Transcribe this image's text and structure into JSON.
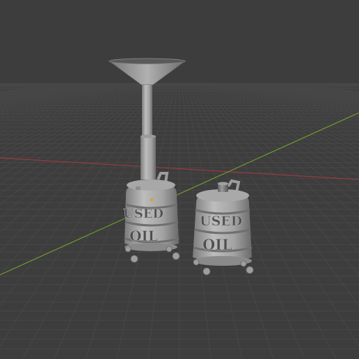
{
  "viewport": {
    "background": "#3d3d3d",
    "grid_color": "#474747",
    "x_axis_color": "#9a3a45",
    "y_axis_color": "#6f9a2c",
    "origin_marker_color": "#e0a020"
  },
  "objects": [
    {
      "name": "used-oil-drain-tank-with-funnel",
      "embossed_text": {
        "line1": "USED",
        "line2": "OIL"
      }
    },
    {
      "name": "used-oil-tank",
      "embossed_text": {
        "line1": "USED",
        "line2": "OIL"
      }
    }
  ]
}
